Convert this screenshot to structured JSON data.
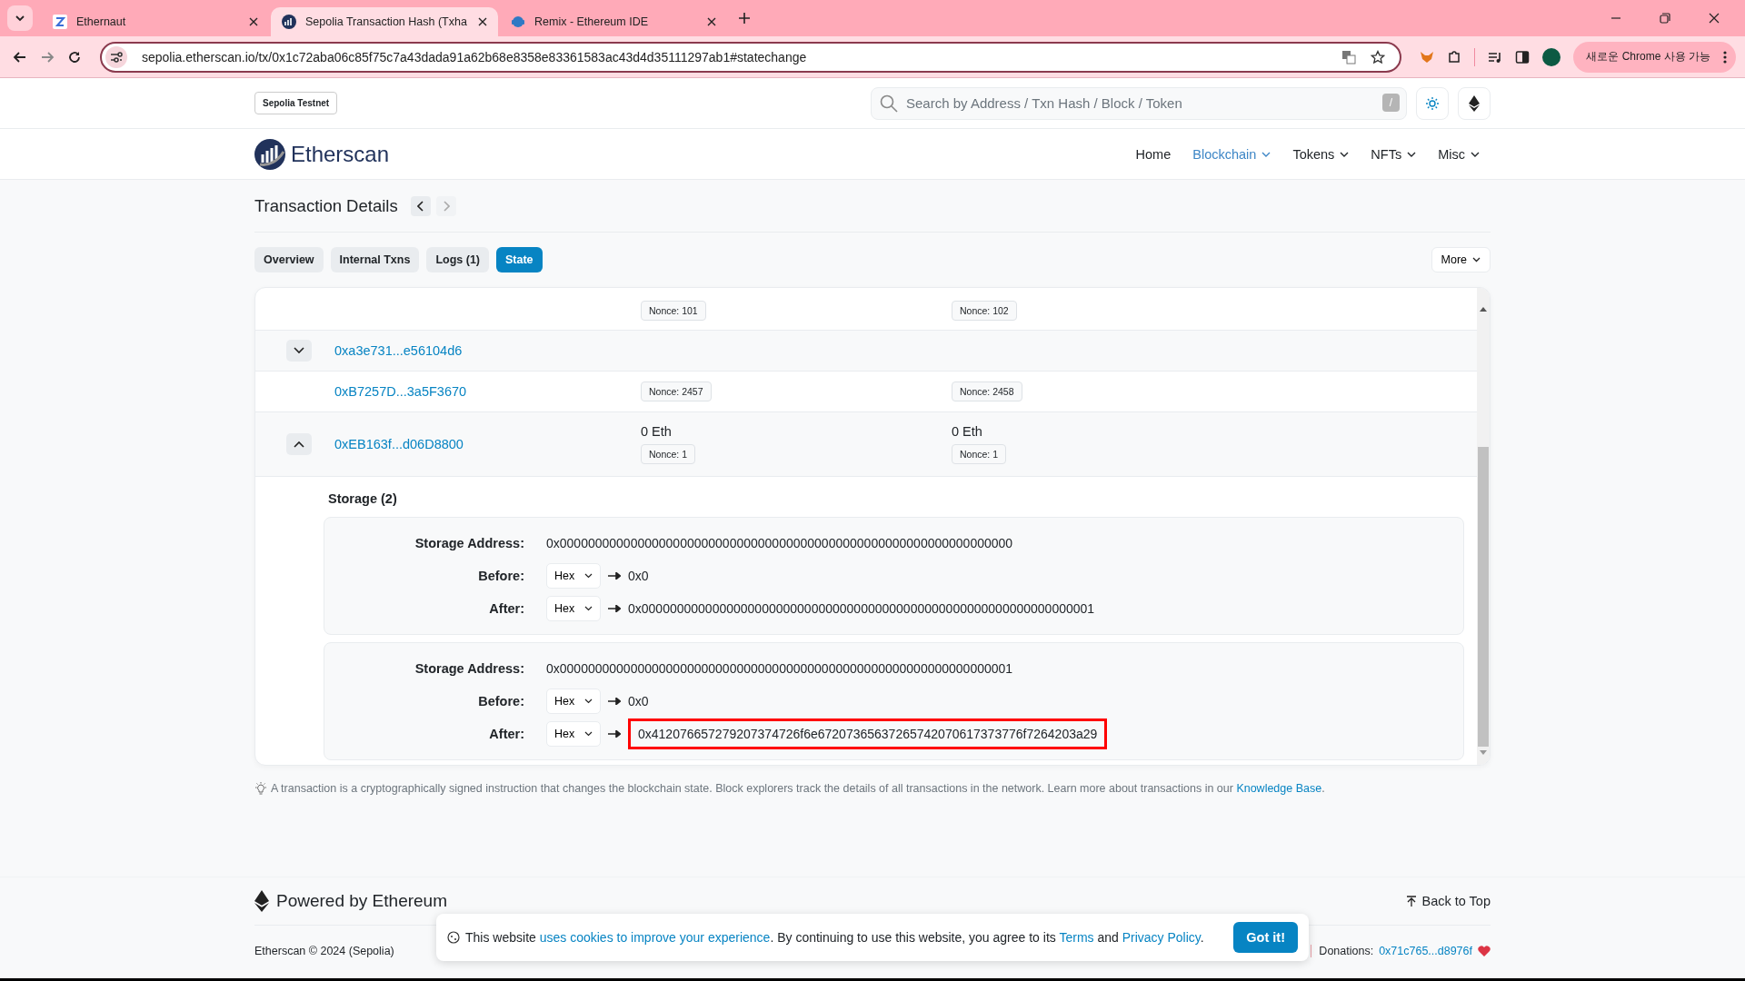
{
  "browser": {
    "tabs": [
      {
        "title": "Ethernaut",
        "kind": "ethernaut",
        "selected": false
      },
      {
        "title": "Sepolia Transaction Hash (Txha",
        "kind": "etherscan",
        "selected": true
      },
      {
        "title": "Remix - Ethereum IDE",
        "kind": "remix",
        "selected": false
      }
    ],
    "url": "sepolia.etherscan.io/tx/0x1c72aba06c85f75c7a43dada91a62b68e8358e83361583ac43d4d35111297ab1#statechange",
    "update_button": "새로운 Chrome 사용 가능"
  },
  "header": {
    "network_badge": "Sepolia Testnet",
    "search": {
      "placeholder": "Search by Address / Txn Hash / Block / Token",
      "shortcut": "/"
    },
    "logo": "Etherscan",
    "nav": [
      {
        "label": "Home",
        "dropdown": false,
        "selected": false
      },
      {
        "label": "Blockchain",
        "dropdown": true,
        "selected": true
      },
      {
        "label": "Tokens",
        "dropdown": true,
        "selected": false
      },
      {
        "label": "NFTs",
        "dropdown": true,
        "selected": false
      },
      {
        "label": "Misc",
        "dropdown": true,
        "selected": false
      }
    ]
  },
  "title": "Transaction Details",
  "tabs": [
    {
      "label": "Overview",
      "selected": false
    },
    {
      "label": "Internal Txns",
      "selected": false
    },
    {
      "label": "Logs (1)",
      "selected": false
    },
    {
      "label": "State",
      "selected": true
    }
  ],
  "more": "More",
  "state_rows": [
    {
      "before_nonce": "Nonce: 101",
      "after_nonce": "Nonce: 102"
    },
    {
      "expanded": false,
      "address": "0xa3e731...e56104d6"
    },
    {
      "address": "0xB7257D...3a5F3670",
      "before_nonce": "Nonce: 2457",
      "after_nonce": "Nonce: 2458"
    },
    {
      "expanded": true,
      "address": "0xEB163f...d06D8800",
      "before_balance": "0 Eth",
      "before_nonce": "Nonce: 1",
      "after_balance": "0 Eth",
      "after_nonce": "Nonce: 1"
    }
  ],
  "storage": {
    "title": "Storage (2)",
    "entries": [
      {
        "address_label": "Storage Address:",
        "before_label": "Before:",
        "after_label": "After:",
        "address": "0x0000000000000000000000000000000000000000000000000000000000000000",
        "before_format": "Hex",
        "before": "0x0",
        "after_format": "Hex",
        "after": "0x0000000000000000000000000000000000000000000000000000000000000001",
        "highlighted": false
      },
      {
        "address_label": "Storage Address:",
        "before_label": "Before:",
        "after_label": "After:",
        "address": "0x0000000000000000000000000000000000000000000000000000000000000001",
        "before_format": "Hex",
        "before": "0x0",
        "after_format": "Hex",
        "after": "0x412076657279207374726f6e67207365637265742070617373776f7264203a29",
        "highlighted": true
      }
    ]
  },
  "footnote": [
    {
      "kind": "text",
      "text": "A transaction is a cryptographically signed instruction that changes the blockchain state. Block explorers track the details of all transactions in the network. Learn more about transactions in our "
    },
    {
      "kind": "link",
      "text": "Knowledge Base"
    },
    {
      "kind": "text",
      "text": "."
    }
  ],
  "footer": {
    "powered": "Powered by Ethereum",
    "back_to_top": "Back to Top",
    "copyright": "Etherscan © 2024 (Sepolia)",
    "donations_label": "Donations:",
    "donations_address": "0x71c765...d8976f"
  },
  "cookie": {
    "segments": [
      {
        "kind": "text",
        "text": "This website "
      },
      {
        "kind": "link",
        "text": "uses cookies to improve your experience"
      },
      {
        "kind": "text",
        "text": ". By continuing to use this website, you agree to its "
      },
      {
        "kind": "link",
        "text": "Terms"
      },
      {
        "kind": "text",
        "text": " and "
      },
      {
        "kind": "link",
        "text": "Privacy Policy"
      },
      {
        "kind": "text",
        "text": "."
      }
    ],
    "button": "Got it!"
  }
}
